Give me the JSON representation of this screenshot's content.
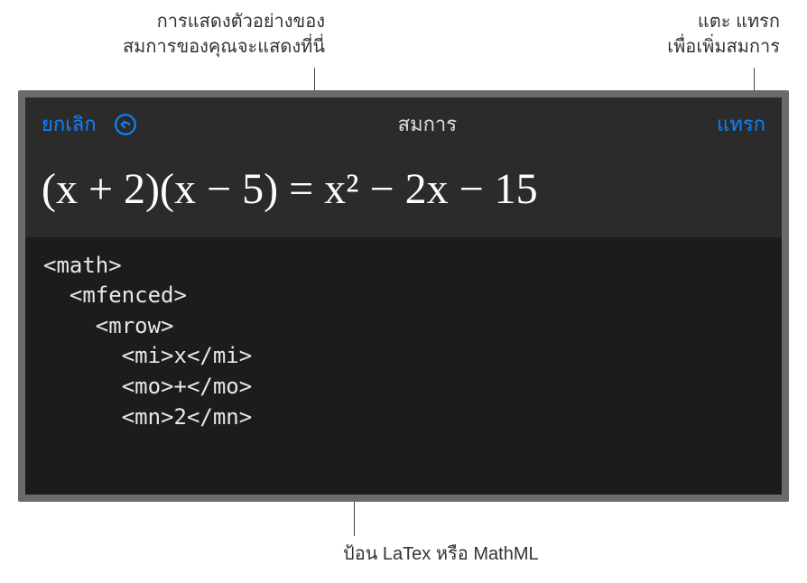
{
  "callouts": {
    "preview": "การแสดงตัวอย่างของ\nสมการของคุณจะแสดงที่นี่",
    "insert": "แตะ แทรก\nเพื่อเพิ่มสมการ",
    "input": "ป้อน LaTex หรือ MathML"
  },
  "header": {
    "cancel": "ยกเลิก",
    "title": "สมการ",
    "insert": "แทรก"
  },
  "preview": {
    "rendered": "(x + 2)(x − 5) = x² − 2x − 15"
  },
  "editor": {
    "code": "<math>\n  <mfenced>\n    <mrow>\n      <mi>x</mi>\n      <mo>+</mo>\n      <mn>2</mn>"
  }
}
